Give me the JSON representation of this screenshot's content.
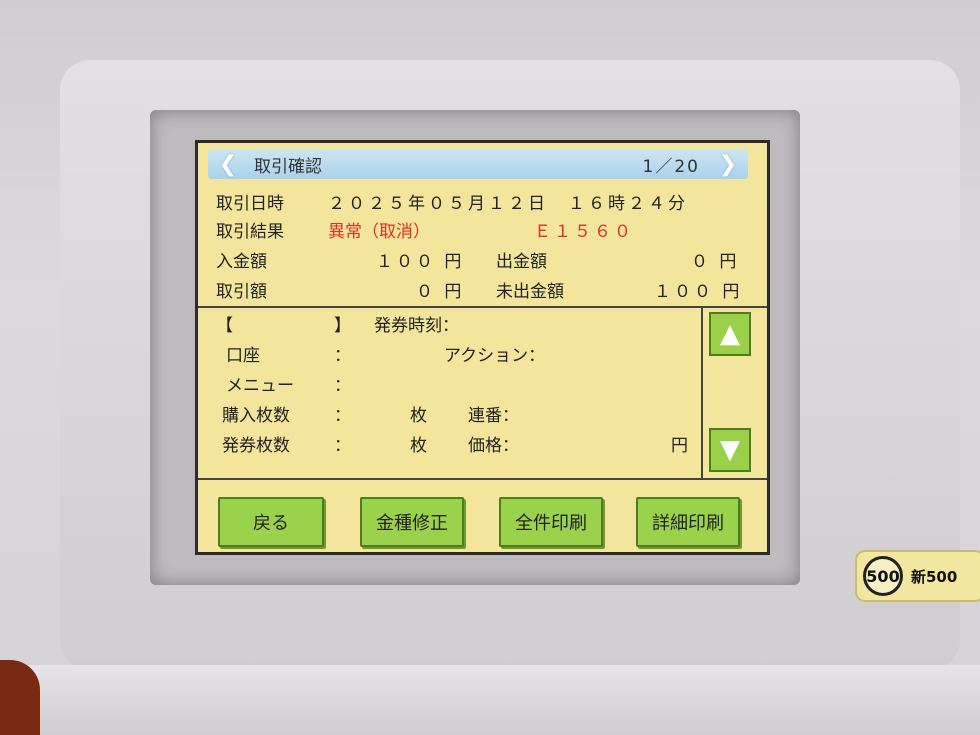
{
  "screen": {
    "title": "取引確認",
    "page": "1／20",
    "summary": {
      "datetime_label": "取引日時",
      "datetime_value": "２０２５年０５月１２日　１６時２４分",
      "result_label": "取引結果",
      "result_value": "異常（取消）",
      "result_code": "Ｅ１５６０",
      "deposit_label": "入金額",
      "deposit_value": "１００ 円",
      "withdraw_label": "出金額",
      "withdraw_value": "０ 円",
      "amount_label": "取引額",
      "amount_value": "０ 円",
      "unpaid_label": "未出金額",
      "unpaid_value": "１００ 円"
    },
    "detail": {
      "bracket_open": "【",
      "bracket_close": "】",
      "issue_time_label": "発券時刻：",
      "account_label": "口座",
      "account_colon": "：",
      "action_label": "アクション：",
      "menu_label": "メニュー",
      "menu_colon": "：",
      "purchase_count_label": "購入枚数",
      "purchase_count_colon": "：",
      "purchase_count_unit": "枚",
      "serial_label": "連番：",
      "issued_count_label": "発券枚数",
      "issued_count_colon": "：",
      "issued_count_unit": "枚",
      "price_label": "価格：",
      "price_unit": "円"
    },
    "buttons": {
      "back": "戻る",
      "denomination_fix": "金種修正",
      "print_all": "全件印刷",
      "print_detail": "詳細印刷"
    },
    "icons": {
      "prev": "chevron-left-icon",
      "next": "chevron-right-icon",
      "scroll_up": "triangle-up-icon",
      "scroll_down": "triangle-down-icon"
    }
  },
  "device": {
    "coin_badge": "500",
    "coin_text": "新500"
  }
}
